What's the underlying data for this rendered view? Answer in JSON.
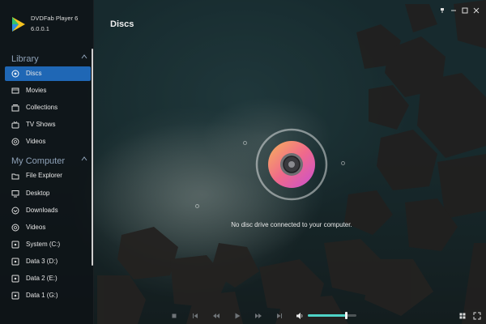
{
  "app": {
    "name": "DVDFab Player 6",
    "version": "6.0.0.1",
    "accent": "#1f67b5"
  },
  "page_title": "Discs",
  "sidebar": {
    "library": {
      "title": "Library",
      "items": [
        {
          "label": "Discs",
          "icon": "disc-icon",
          "active": true
        },
        {
          "label": "Movies",
          "icon": "film-icon"
        },
        {
          "label": "Collections",
          "icon": "collections-icon"
        },
        {
          "label": "TV Shows",
          "icon": "tv-icon"
        },
        {
          "label": "Videos",
          "icon": "video-icon"
        }
      ]
    },
    "my_computer": {
      "title": "My Computer",
      "items": [
        {
          "label": "File Explorer",
          "icon": "folder-icon"
        },
        {
          "label": "Desktop",
          "icon": "monitor-icon"
        },
        {
          "label": "Downloads",
          "icon": "download-icon"
        },
        {
          "label": "Videos",
          "icon": "video-icon"
        },
        {
          "label": "System (C:)",
          "icon": "drive-icon"
        },
        {
          "label": "Data 3 (D:)",
          "icon": "drive-icon"
        },
        {
          "label": "Data 2 (E:)",
          "icon": "drive-icon"
        },
        {
          "label": "Data 1 (G:)",
          "icon": "drive-icon"
        }
      ]
    }
  },
  "empty_state": {
    "message": "No disc drive connected to your computer.",
    "icon": "disc-icon"
  },
  "player": {
    "volume_percent": 78,
    "volume_color": "#4fd3c6",
    "controls": [
      "stop-icon",
      "previous-icon",
      "rewind-icon",
      "play-icon",
      "fast-forward-icon",
      "next-icon",
      "volume-icon",
      "grid-view-icon",
      "fullscreen-icon"
    ]
  },
  "window_controls": [
    "pin-icon",
    "minimize-icon",
    "maximize-icon",
    "close-icon"
  ]
}
